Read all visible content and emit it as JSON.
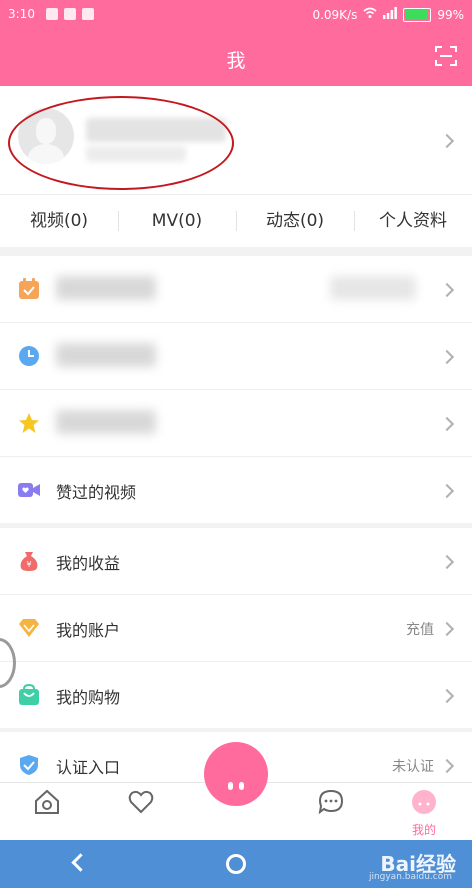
{
  "status_bar": {
    "time": "3:10",
    "network_speed": "0.09K/s",
    "battery": "99%"
  },
  "header": {
    "title": "我"
  },
  "tabs": [
    {
      "label": "视频(0)"
    },
    {
      "label": "MV(0)"
    },
    {
      "label": "动态(0)"
    },
    {
      "label": "个人资料"
    }
  ],
  "menu_group_1": [
    {
      "label": "",
      "value": "",
      "icon": "calendar-icon"
    },
    {
      "label": "",
      "value": "",
      "icon": "clock-icon"
    },
    {
      "label": "",
      "value": "",
      "icon": "star-icon"
    },
    {
      "label": "赞过的视频",
      "value": "",
      "icon": "video-icon"
    }
  ],
  "menu_group_2": [
    {
      "label": "我的收益",
      "value": "",
      "icon": "money-bag-icon"
    },
    {
      "label": "我的账户",
      "value": "充值",
      "icon": "diamond-icon"
    },
    {
      "label": "我的购物",
      "value": "",
      "icon": "shopping-bag-icon"
    }
  ],
  "menu_group_3": [
    {
      "label": "认证入口",
      "value": "未认证",
      "icon": "shield-icon"
    }
  ],
  "bottom_nav": [
    {
      "label": "",
      "icon": "home-icon"
    },
    {
      "label": "",
      "icon": "heart-icon"
    },
    {
      "label": "",
      "icon": "chat-icon"
    },
    {
      "label": "我的",
      "icon": "profile-face-icon"
    }
  ],
  "watermark": {
    "brand": "Bai经验",
    "url": "jingyan.baidu.com"
  },
  "colors": {
    "accent": "#ff6b9d",
    "system_bar": "#4f8fd6",
    "annotation": "#c4181f"
  }
}
